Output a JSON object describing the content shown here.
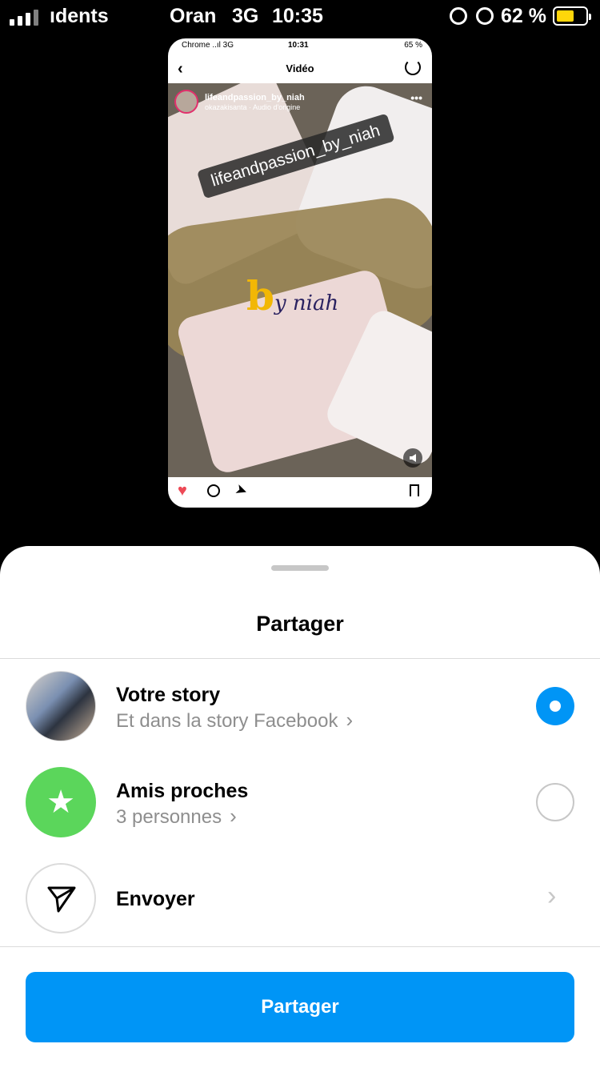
{
  "status_bar": {
    "carrier": "ıdents",
    "carrier2": "Oran",
    "network": "3G",
    "time": "10:35",
    "battery": "62 %",
    "battery_level": 0.62,
    "battery_color": "#ffd60a"
  },
  "preview": {
    "status_left": "Chrome ..ıl 3G",
    "status_time": "10:31",
    "status_right": "65 %",
    "header_title": "Vidéo",
    "username": "lifeandpassion_by_niah",
    "subtitle": "okazakisanta · Audio d'origine",
    "more": "•••",
    "tag_text": "lifeandpassion_by_niah",
    "logo_b": "b",
    "logo_rest": "y niah",
    "icons": [
      "back-icon",
      "reload-icon",
      "heart-icon",
      "comment-icon",
      "send-icon",
      "bookmark-icon",
      "home-icon",
      "search-icon",
      "add-icon",
      "reels-icon",
      "profile-icon",
      "mute-icon"
    ]
  },
  "sheet": {
    "title": "Partager",
    "rows": [
      {
        "title": "Votre story",
        "subtitle": "Et dans la story Facebook",
        "selected": true
      },
      {
        "title": "Amis proches",
        "subtitle": "3 personnes",
        "selected": false
      },
      {
        "title": "Envoyer"
      }
    ],
    "button_label": "Partager",
    "accent_color": "#0095f6",
    "close_friends_color": "#5bd65b"
  }
}
